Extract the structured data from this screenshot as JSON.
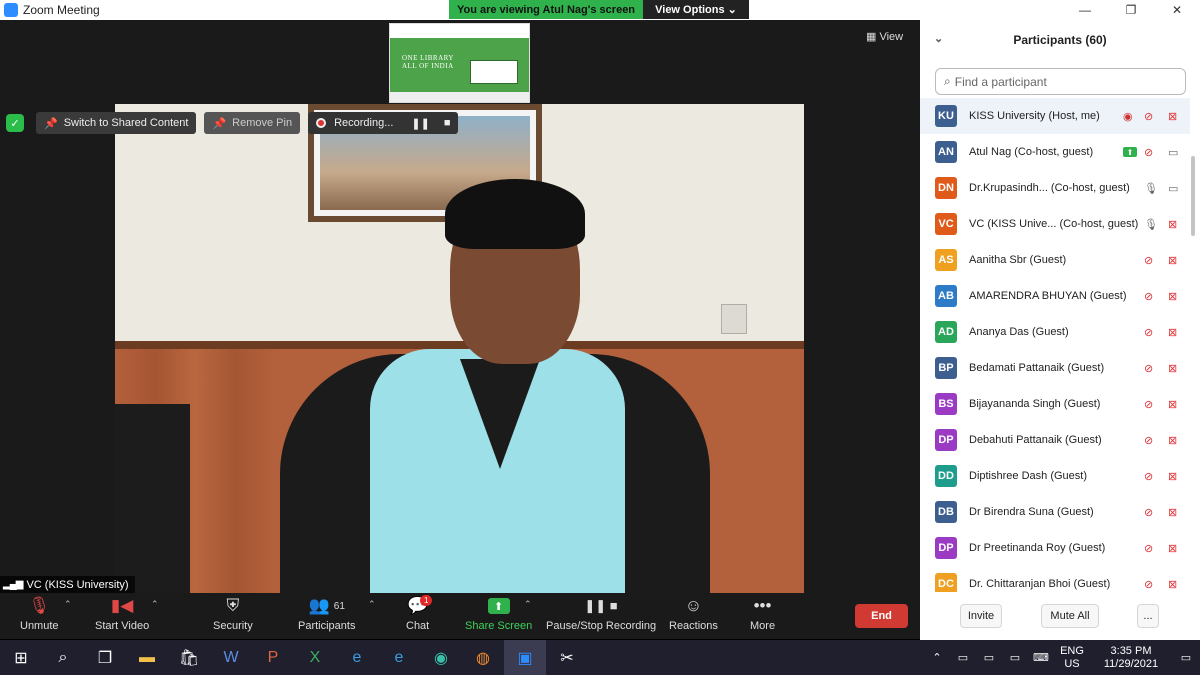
{
  "window": {
    "title": "Zoom Meeting",
    "min": "—",
    "max": "❐",
    "close": "✕"
  },
  "banner": {
    "message": "You are viewing Atul Nag's screen",
    "view_options": "View Options ⌄"
  },
  "stage": {
    "view_label": "View",
    "switch_label": "Switch to Shared Content",
    "remove_pin_label": "Remove Pin",
    "recording_label": "Recording...",
    "shared_thumb_title": "ONE LIBRARY\nALL OF INDIA",
    "speaker_label": "VC (KISS University)"
  },
  "toolbar": {
    "unmute": "Unmute",
    "start_video": "Start Video",
    "security": "Security",
    "participants": "Participants",
    "participants_count": "61",
    "chat": "Chat",
    "chat_badge": "1",
    "share_screen": "Share Screen",
    "pause_stop": "Pause/Stop Recording",
    "reactions": "Reactions",
    "more": "More",
    "end": "End"
  },
  "panel": {
    "title": "Participants (60)",
    "search_placeholder": "Find a participant",
    "invite": "Invite",
    "mute_all": "Mute All",
    "more": "...",
    "participants": [
      {
        "initials": "KU",
        "color": "#3d5f8f",
        "name": "KISS University (Host, me)",
        "mic": "off",
        "video": "off",
        "extra": "rec"
      },
      {
        "initials": "AN",
        "color": "#3d5f8f",
        "name": "Atul Nag (Co-host, guest)",
        "mic": "off",
        "video": "on",
        "extra": "share"
      },
      {
        "initials": "DN",
        "color": "#e05a1a",
        "name": "Dr.Krupasindh... (Co-host, guest)",
        "mic": "on",
        "video": "on",
        "extra": ""
      },
      {
        "initials": "VC",
        "color": "#e05a1a",
        "name": "VC (KISS Unive... (Co-host, guest)",
        "mic": "on",
        "video": "off",
        "extra": ""
      },
      {
        "initials": "AS",
        "color": "#f0a020",
        "name": "Aanitha Sbr (Guest)",
        "mic": "off",
        "video": "off",
        "extra": ""
      },
      {
        "initials": "AB",
        "color": "#2d7bc6",
        "name": "AMARENDRA BHUYAN (Guest)",
        "mic": "off",
        "video": "off",
        "extra": ""
      },
      {
        "initials": "AD",
        "color": "#2aa65a",
        "name": "Ananya Das (Guest)",
        "mic": "off",
        "video": "off",
        "extra": ""
      },
      {
        "initials": "BP",
        "color": "#3d5f8f",
        "name": "Bedamati Pattanaik (Guest)",
        "mic": "off",
        "video": "off",
        "extra": ""
      },
      {
        "initials": "BS",
        "color": "#9b3bc4",
        "name": "Bijayananda Singh (Guest)",
        "mic": "off",
        "video": "off",
        "extra": ""
      },
      {
        "initials": "DP",
        "color": "#9b3bc4",
        "name": "Debahuti Pattanaik (Guest)",
        "mic": "off",
        "video": "off",
        "extra": ""
      },
      {
        "initials": "DD",
        "color": "#1e9c8c",
        "name": "Diptishree Dash (Guest)",
        "mic": "off",
        "video": "off",
        "extra": ""
      },
      {
        "initials": "DB",
        "color": "#3d5f8f",
        "name": "Dr Birendra Suna (Guest)",
        "mic": "off",
        "video": "off",
        "extra": ""
      },
      {
        "initials": "DP",
        "color": "#9b3bc4",
        "name": "Dr Preetinanda Roy (Guest)",
        "mic": "off",
        "video": "off",
        "extra": ""
      },
      {
        "initials": "DC",
        "color": "#f0a020",
        "name": "Dr. Chittaranjan Bhoi (Guest)",
        "mic": "off",
        "video": "off",
        "extra": ""
      }
    ]
  },
  "taskbar": {
    "lang_top": "ENG",
    "lang_bottom": "US",
    "time": "3:35 PM",
    "date": "11/29/2021"
  }
}
